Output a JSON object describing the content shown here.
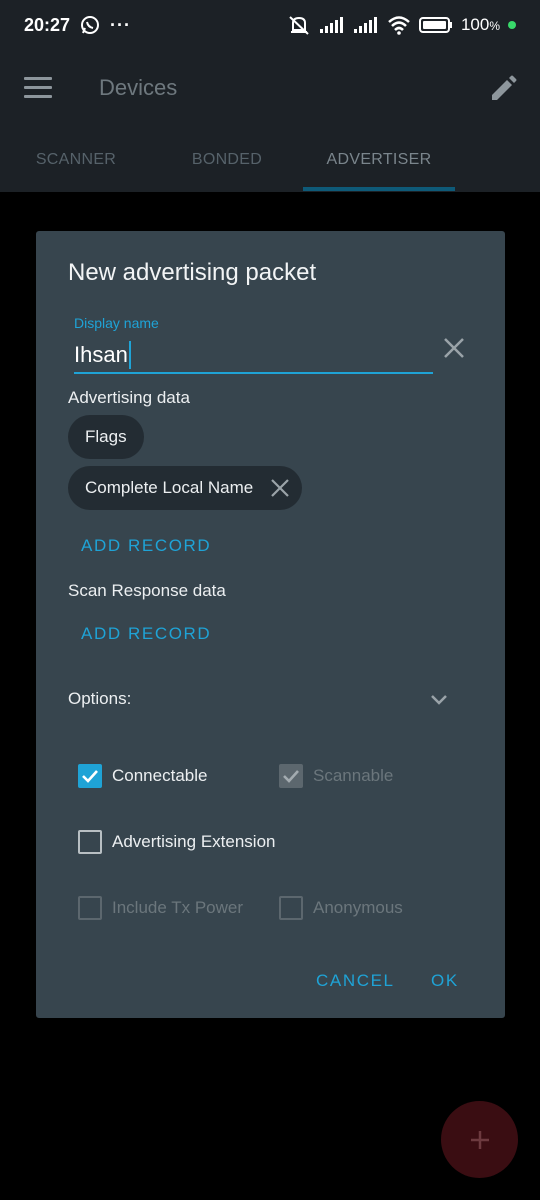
{
  "status": {
    "time": "20:27",
    "overflow": "···",
    "battery": "100",
    "battery_unit": "%"
  },
  "app_bar": {
    "title": "Devices"
  },
  "tabs": [
    {
      "label": "SCANNER"
    },
    {
      "label": "BONDED"
    },
    {
      "label": "ADVERTISER"
    }
  ],
  "dialog": {
    "title": "New advertising packet",
    "display_name": {
      "label": "Display name",
      "value": "Ihsan"
    },
    "advertising_data": {
      "label": "Advertising data",
      "chips": [
        "Flags",
        "Complete Local Name"
      ],
      "add_record": "ADD RECORD"
    },
    "scan_response": {
      "label": "Scan Response data",
      "add_record": "ADD RECORD"
    },
    "options": {
      "label": "Options:",
      "connectable": "Connectable",
      "scannable": "Scannable",
      "advertising_extension": "Advertising Extension",
      "include_tx_power": "Include Tx Power",
      "anonymous": "Anonymous"
    },
    "cancel": "CANCEL",
    "ok": "OK"
  },
  "colors": {
    "accent": "#1fa3d6",
    "dialog_bg": "#37454e",
    "app_bar_bg": "#1c2126",
    "fab": "#3a0d12"
  },
  "icons": [
    "whatsapp-icon",
    "mute-icon",
    "signal-icon",
    "wifi-icon",
    "battery-icon",
    "menu-icon",
    "edit-icon",
    "clear-icon",
    "chevron-down-icon",
    "check-icon",
    "plus-icon"
  ]
}
